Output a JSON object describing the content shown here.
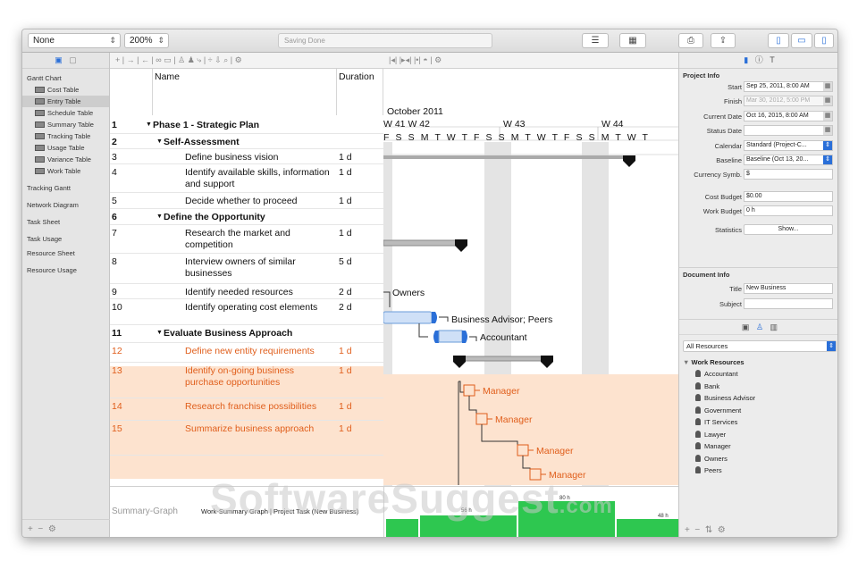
{
  "toolbar": {
    "filter_value": "None",
    "zoom_value": "200%",
    "status": "Saving Done"
  },
  "sidebar": {
    "groups": [
      {
        "label": "Gantt Chart"
      },
      {
        "label": "Tracking Gantt"
      },
      {
        "label": "Network Diagram"
      },
      {
        "label": "Task Sheet"
      },
      {
        "label": "Task Usage"
      },
      {
        "label": "Resource Sheet"
      },
      {
        "label": "Resource Usage"
      }
    ],
    "tables": [
      {
        "label": "Cost Table"
      },
      {
        "label": "Entry Table"
      },
      {
        "label": "Schedule Table"
      },
      {
        "label": "Summary Table"
      },
      {
        "label": "Tracking Table"
      },
      {
        "label": "Usage Table"
      },
      {
        "label": "Variance Table"
      },
      {
        "label": "Work Table"
      }
    ]
  },
  "table": {
    "headers": {
      "name": "Name",
      "duration": "Duration"
    },
    "rows": [
      {
        "id": "1",
        "name": "Phase 1 - Strategic Plan",
        "duration": ""
      },
      {
        "id": "2",
        "name": "Self-Assessment",
        "duration": ""
      },
      {
        "id": "3",
        "name": "Define business vision",
        "duration": "1 d"
      },
      {
        "id": "4",
        "name": "Identify available skills, information and support",
        "duration": "1 d"
      },
      {
        "id": "5",
        "name": "Decide whether to proceed",
        "duration": "1 d"
      },
      {
        "id": "6",
        "name": "Define the Opportunity",
        "duration": ""
      },
      {
        "id": "7",
        "name": "Research the market and competition",
        "duration": "1 d"
      },
      {
        "id": "8",
        "name": "Interview owners of similar businesses",
        "duration": "5 d"
      },
      {
        "id": "9",
        "name": "Identify needed resources",
        "duration": "2 d"
      },
      {
        "id": "10",
        "name": "Identify operating cost elements",
        "duration": "2 d"
      },
      {
        "id": "11",
        "name": "Evaluate Business Approach",
        "duration": ""
      },
      {
        "id": "12",
        "name": "Define new entity requirements",
        "duration": "1 d"
      },
      {
        "id": "13",
        "name": "Identify on-going business purchase opportunities",
        "duration": "1 d"
      },
      {
        "id": "14",
        "name": "Research franchise possibilities",
        "duration": "1 d"
      },
      {
        "id": "15",
        "name": "Summarize business approach",
        "duration": "1 d"
      }
    ]
  },
  "gantt": {
    "month": "October 2011",
    "weeks": [
      "W 41",
      "W 42",
      "W 43",
      "W 44"
    ],
    "days": "F S S M T W T F S S M T W T F S S M T W T",
    "labels": {
      "owners": "Owners",
      "advisor_peers": "Business Advisor; Peers",
      "accountant": "Accountant",
      "manager": "Manager"
    }
  },
  "summary": {
    "label": "Summary-Graph",
    "desc": "Work-Summary Graph | Project Task (New Business)",
    "bars": [
      {
        "label": "56 h"
      },
      {
        "label": "80 h"
      },
      {
        "label": "48 h"
      }
    ],
    "watermark": "SoftwareSuggest",
    "watermark_suffix": ".com"
  },
  "inspector": {
    "project_info": "Project Info",
    "fields": [
      {
        "label": "Start",
        "value": "Sep 25, 2011, 8:00 AM"
      },
      {
        "label": "Finish",
        "value": "Mar 30, 2012, 5:00 PM"
      },
      {
        "label": "Current Date",
        "value": "Oct 16, 2015, 8:00 AM"
      },
      {
        "label": "Status Date",
        "value": ""
      },
      {
        "label": "Calendar",
        "value": "Standard (Project-C..."
      },
      {
        "label": "Baseline",
        "value": "Baseline (Oct 13, 20..."
      },
      {
        "label": "Currency Symb.",
        "value": "$"
      },
      {
        "label": "Cost Budget",
        "value": "$0.00"
      },
      {
        "label": "Work Budget",
        "value": "0 h"
      },
      {
        "label": "Statistics",
        "value": "Show..."
      }
    ],
    "document_info": "Document Info",
    "doc_fields": [
      {
        "label": "Title",
        "value": "New Business"
      },
      {
        "label": "Subject",
        "value": ""
      }
    ],
    "resource_filter": "All Resources",
    "resource_group": "Work Resources",
    "resources": [
      "Accountant",
      "Bank",
      "Business Advisor",
      "Government",
      "IT Services",
      "Lawyer",
      "Manager",
      "Owners",
      "Peers"
    ]
  }
}
